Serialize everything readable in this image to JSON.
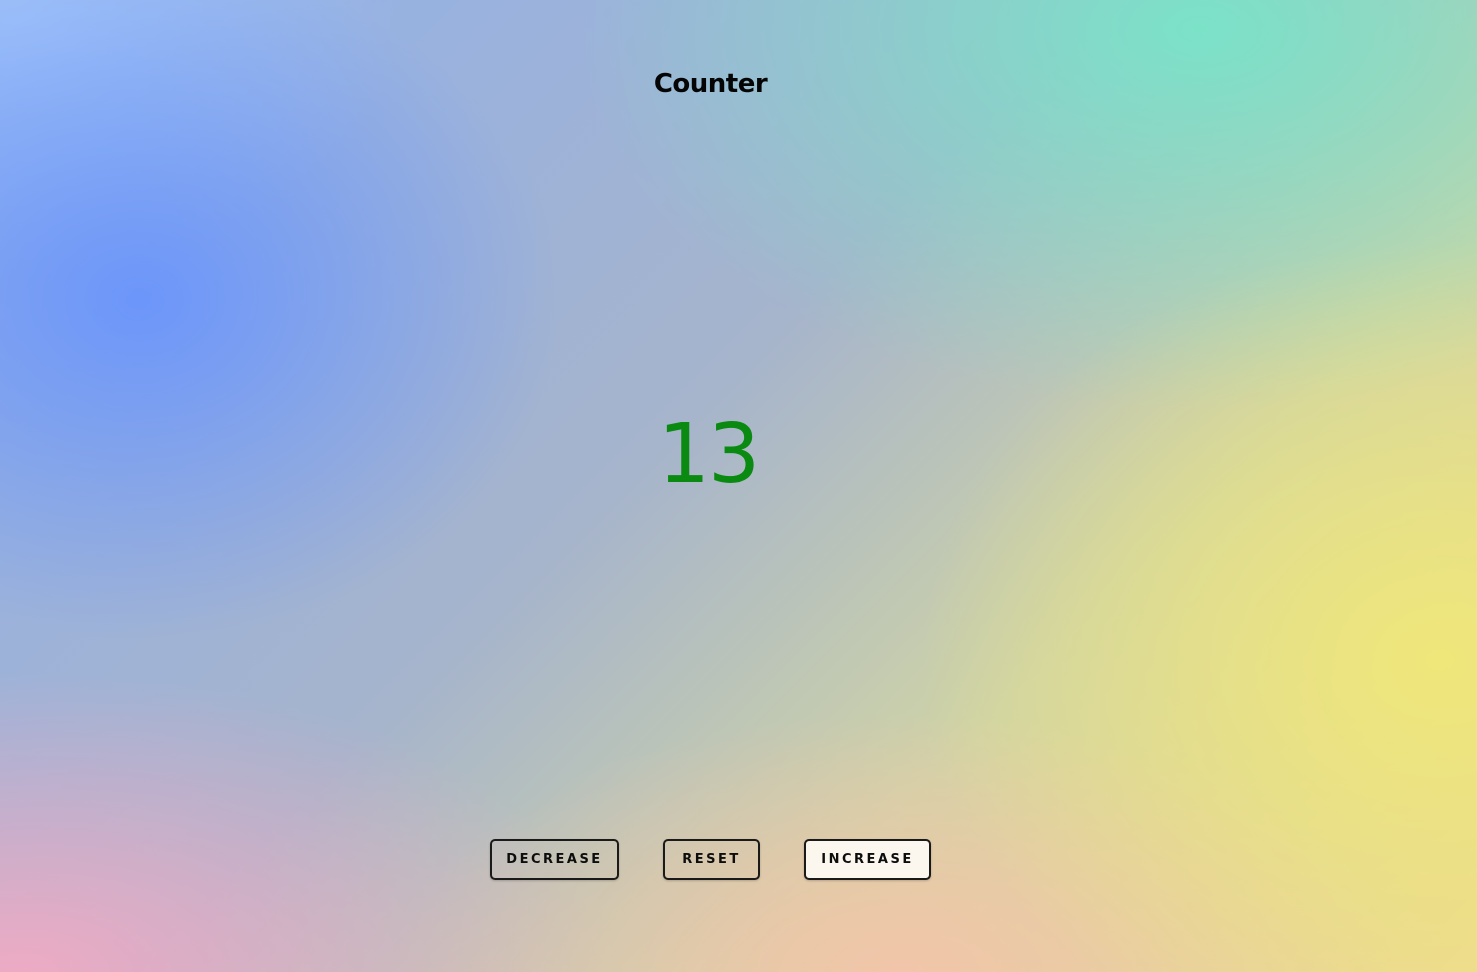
{
  "header": {
    "title": "Counter"
  },
  "counter": {
    "value": "13",
    "value_color": "#0b8a12"
  },
  "buttons": {
    "decrease_label": "DECREASE",
    "reset_label": "RESET",
    "increase_label": "INCREASE"
  }
}
